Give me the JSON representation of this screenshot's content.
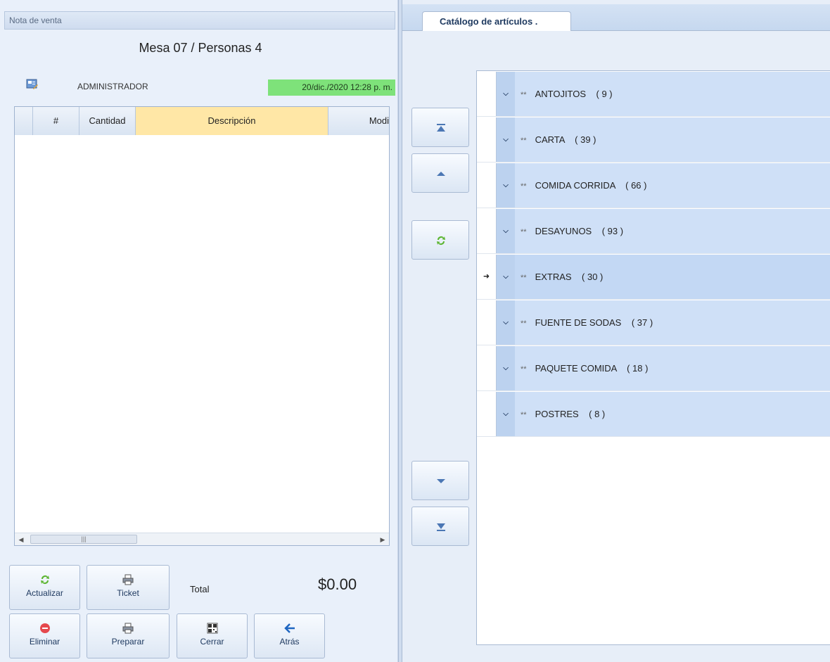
{
  "left_panel": {
    "header_title": "Nota de venta",
    "mesa_title": "Mesa 07 / Personas 4",
    "user": "ADMINISTRADOR",
    "datetime": "20/dic./2020 12:28 p. m.",
    "grid": {
      "columns": [
        "",
        "#",
        "Cantidad",
        "Descripción",
        "Modi"
      ],
      "rows": []
    },
    "total_label": "Total",
    "total_value": "$0.00",
    "buttons": {
      "actualizar": "Actualizar",
      "ticket": "Ticket",
      "eliminar": "Eliminar",
      "preparar": "Preparar",
      "cerrar": "Cerrar",
      "atras": "Atrás"
    },
    "icons": {
      "actualizar": "refresh-icon",
      "ticket": "printer-icon",
      "eliminar": "delete-icon",
      "preparar": "printer-icon",
      "cerrar": "qr-code-icon",
      "atras": "arrow-left-icon"
    }
  },
  "right_panel": {
    "tab_label": "Catálogo de artículos   .",
    "nav_buttons": [
      "move-first-icon",
      "move-up-icon",
      "refresh-icon",
      "move-down-icon",
      "move-last-icon"
    ],
    "categories": [
      {
        "prefix": "**",
        "name": "ANTOJITOS",
        "count": "( 9 )"
      },
      {
        "prefix": "**",
        "name": "CARTA",
        "count": "( 39 )"
      },
      {
        "prefix": "**",
        "name": "COMIDA CORRIDA",
        "count": "( 66 )"
      },
      {
        "prefix": "**",
        "name": "DESAYUNOS",
        "count": "( 93 )"
      },
      {
        "prefix": "**",
        "name": "EXTRAS",
        "count": "( 30 )"
      },
      {
        "prefix": "**",
        "name": "FUENTE DE SODAS",
        "count": "( 37 )"
      },
      {
        "prefix": "**",
        "name": "PAQUETE COMIDA",
        "count": "( 18 )"
      },
      {
        "prefix": "**",
        "name": "POSTRES",
        "count": "( 8 )"
      }
    ],
    "active_category_index": 4
  },
  "colors": {
    "accent": "#1f3a60",
    "date_badge": "#7ee27a",
    "selected_column": "#ffe7a6",
    "group_row": "#cfe0f7"
  }
}
